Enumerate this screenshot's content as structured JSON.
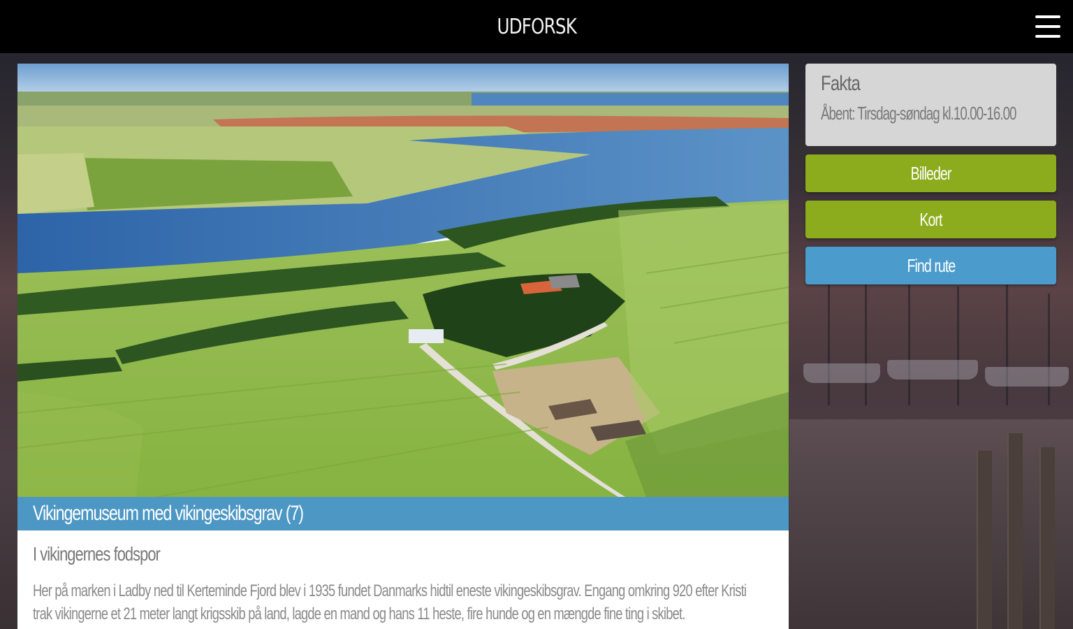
{
  "header": {
    "title": "UDFORSK",
    "menu_icon": "hamburger-menu-icon"
  },
  "article": {
    "image_alt": "Aerial view of Ladby fields and Kerteminde Fjord",
    "title": "Vikingemuseum med vikingeskibsgrav (7)",
    "subtitle": "I vikingernes fodspor",
    "text": "Her på marken i Ladby ned til Kerteminde Fjord blev i 1935 fundet Danmarks hidtil eneste vikingeskibsgrav. Engang omkring 920 efter Kristi trak vikingerne et 21 meter langt krigsskib på land, lagde en mand og hans 11 heste, fire hunde og en mængde fine ting i skibet."
  },
  "facts": {
    "title": "Fakta",
    "text": "Åbent: Tirsdag-søndag kl.10.00-16.00"
  },
  "buttons": {
    "images": "Billeder",
    "map": "Kort",
    "route": "Find rute"
  },
  "colors": {
    "green_button": "#8cab1d",
    "blue_accent": "#4d97c4",
    "fact_box": "#d6d6d6"
  }
}
